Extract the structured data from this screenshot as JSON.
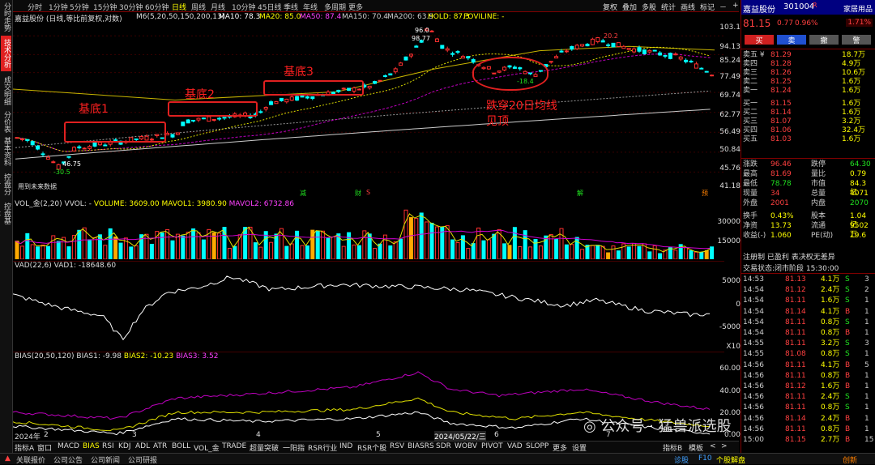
{
  "left_tabs": [
    "分时走势",
    "技术分析",
    "成交明细",
    "分价表",
    "基本资料",
    "控盘分析",
    "控盘基本"
  ],
  "timeframes": [
    "分时",
    "1分钟",
    "5分钟",
    "15分钟",
    "30分钟",
    "60分钟",
    "日线",
    "周线",
    "月线",
    "10分钟",
    "45日线",
    "季线",
    "年线",
    "多周期",
    "更多"
  ],
  "top_buttons": [
    "复权",
    "叠加",
    "多股",
    "统计",
    "画线",
    "标记",
    "－",
    "+"
  ],
  "ma_line": {
    "title": "嘉益股份 (日线,等比前复权,对数)",
    "m6": "M6(5,20,50,150,200,13)",
    "ma10": "MA10: 78.3",
    "ma20": "MA20: 85.0",
    "ma50": "MA50: 87.4",
    "ma150": "MA150: 70.4",
    "ma200": "MA200: 63.9",
    "hold": "HOLD: 87.3",
    "poviline": "POVILINE: -"
  },
  "y_labels": [
    "103.1",
    "94.13",
    "85.24",
    "77.49",
    "69.74",
    "62.77",
    "56.49",
    "50.84",
    "45.76",
    "41.18"
  ],
  "price_labels": {
    "p1": "96.0",
    "p2": "98.77",
    "p3": "20.2",
    "p4": "-18.4",
    "p5": "46.75",
    "p6": "-30.5"
  },
  "annotations": {
    "a1": "基底1",
    "a2": "基底2",
    "a3": "基底3",
    "a4": "跌穿20日均线",
    "a5": "见顶"
  },
  "bottom_watermark": "用到未来数据",
  "event_marks": [
    "减",
    "财",
    "S",
    "解",
    "预"
  ],
  "vol": {
    "title": "VOL_金(2,20)",
    "vvol": "VVOL: -",
    "volume": "VOLUME: 3609.00",
    "mavol1": "MAVOL1: 3980.90",
    "mavol2": "MAVOL2: 6732.86",
    "y": [
      "30000",
      "15000"
    ]
  },
  "vad": {
    "title": "VAD(22,6)",
    "vad1": "VAD1: -18648.60",
    "y": [
      "5000",
      "0",
      "-5000"
    ],
    "x10": "X10"
  },
  "bias": {
    "title": "BIAS(20,50,120)",
    "b1": "BIAS1: -9.98",
    "b2": "BIAS2: -10.23",
    "b3": "BIAS3: 3.52",
    "y": [
      "60.00",
      "40.00",
      "20.00",
      "0.00"
    ]
  },
  "x_axis": [
    "2024年",
    "2",
    "3",
    "4",
    "5",
    "2024/05/22/三",
    "6",
    "7"
  ],
  "bottom_tabs": [
    "指标A",
    "窗口",
    "MACD",
    "BIAS",
    "RSI",
    "KDJ",
    "ADL",
    "ATR",
    "BOLL",
    "VOL_金",
    "TRADE",
    "超量突破",
    "一阳指",
    "RSR行业",
    "IND",
    "RSR个股",
    "RSV",
    "BIASRS",
    "SDR",
    "WOBV",
    "PIVOT",
    "VAD",
    "SLOPP",
    "更多",
    "设置",
    "指标B",
    "模板",
    "<",
    ">"
  ],
  "status": [
    "关联报价",
    "公司公告",
    "公司新闻",
    "公司研报",
    "诊股",
    "F10",
    "个股解盘",
    "创新"
  ],
  "right_panel": {
    "name": "嘉益股份",
    "code": "301004",
    "tag": "R",
    "family": "家居用品",
    "price": "81.15",
    "chg": "0.77",
    "pct": "0.96%",
    "ratio": "1.71%",
    "buttons": [
      "买",
      "卖",
      "撤",
      "警"
    ],
    "sells": [
      [
        "卖五 ¥",
        "81.29",
        "18.7万"
      ],
      [
        "卖四",
        "81.28",
        "4.9万"
      ],
      [
        "卖三",
        "81.26",
        "10.6万"
      ],
      [
        "卖二",
        "81.25",
        "1.6万"
      ],
      [
        "卖一",
        "81.24",
        "1.6万"
      ]
    ],
    "buys": [
      [
        "买一",
        "81.15",
        "1.6万"
      ],
      [
        "买二",
        "81.14",
        "1.6万"
      ],
      [
        "买三",
        "81.07",
        "3.2万"
      ],
      [
        "买四",
        "81.06",
        "32.4万"
      ],
      [
        "买五",
        "81.03",
        "1.6万"
      ]
    ],
    "stats": [
      [
        "涨跌",
        "96.46",
        "跌停",
        "64.30"
      ],
      [
        "最高",
        "81.69",
        "量比",
        "0.79"
      ],
      [
        "最低",
        "78.78",
        "市值",
        "84.3亿"
      ],
      [
        "现量",
        "34",
        "总量",
        "4071"
      ],
      [
        "外盘",
        "2001",
        "内盘",
        "2070"
      ]
    ],
    "stats2": [
      [
        "换手",
        "0.43%",
        "股本",
        "1.04亿"
      ],
      [
        "净资",
        "13.73",
        "流通",
        "9502万"
      ],
      [
        "收益(-)",
        "1.060",
        "PE(动)",
        "19.6"
      ]
    ],
    "reg": "注册制 已盈利 表决权无差异",
    "trade_status": "交易状态:闭市阶段 15:30:00",
    "ticks": [
      [
        "14:53",
        "81.13",
        "4.1万",
        "S",
        "3"
      ],
      [
        "14:54",
        "81.12",
        "2.4万",
        "S",
        "2"
      ],
      [
        "14:54",
        "81.11",
        "1.6万",
        "S",
        "1"
      ],
      [
        "14:54",
        "81.14",
        "4.1万",
        "B",
        "1"
      ],
      [
        "14:54",
        "81.11",
        "0.8万",
        "S",
        "1"
      ],
      [
        "14:54",
        "81.11",
        "0.8万",
        "B",
        "1"
      ],
      [
        "14:55",
        "81.11",
        "3.2万",
        "S",
        "3"
      ],
      [
        "14:55",
        "81.08",
        "0.8万",
        "S",
        "1"
      ],
      [
        "14:56",
        "81.11",
        "4.1万",
        "B",
        "5"
      ],
      [
        "14:56",
        "81.11",
        "0.8万",
        "B",
        "1"
      ],
      [
        "14:56",
        "81.12",
        "1.6万",
        "B",
        "1"
      ],
      [
        "14:56",
        "81.11",
        "2.4万",
        "S",
        "1"
      ],
      [
        "14:56",
        "81.11",
        "0.8万",
        "S",
        "1"
      ],
      [
        "14:56",
        "81.14",
        "2.4万",
        "B",
        "1"
      ],
      [
        "14:56",
        "81.11",
        "0.8万",
        "B",
        "1"
      ],
      [
        "15:00",
        "81.15",
        "2.7万",
        "B",
        "15"
      ]
    ]
  },
  "watermark": "公众号 · 猛兽派选股",
  "colors": {
    "up": "#ff3030",
    "down": "#00ffff",
    "ma10": "#ffffff",
    "ma20": "#ffff00",
    "ma50": "#ff00ff",
    "ma150": "#c0c0c0",
    "accent": "#e02020"
  }
}
